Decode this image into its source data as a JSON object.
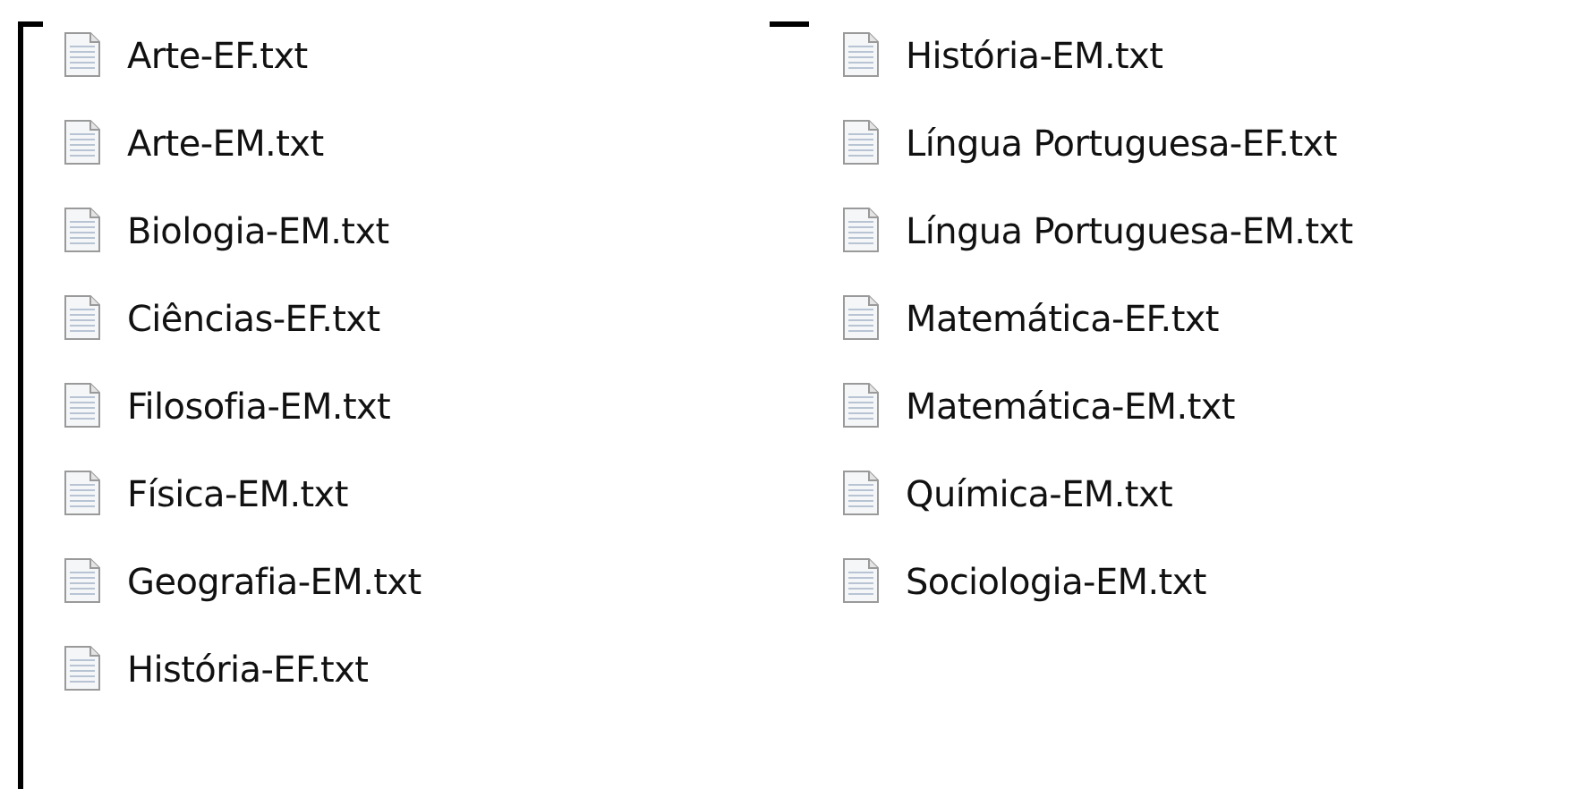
{
  "files": [
    {
      "name": "Arte-EF.txt"
    },
    {
      "name": "Arte-EM.txt"
    },
    {
      "name": "Biologia-EM.txt"
    },
    {
      "name": "Ciências-EF.txt"
    },
    {
      "name": "Filosofia-EM.txt"
    },
    {
      "name": "Física-EM.txt"
    },
    {
      "name": "Geografia-EM.txt"
    },
    {
      "name": "História-EF.txt"
    },
    {
      "name": "História-EM.txt"
    },
    {
      "name": "Língua Portuguesa-EF.txt"
    },
    {
      "name": "Língua Portuguesa-EM.txt"
    },
    {
      "name": "Matemática-EF.txt"
    },
    {
      "name": "Matemática-EM.txt"
    },
    {
      "name": "Química-EM.txt"
    },
    {
      "name": "Sociologia-EM.txt"
    }
  ]
}
